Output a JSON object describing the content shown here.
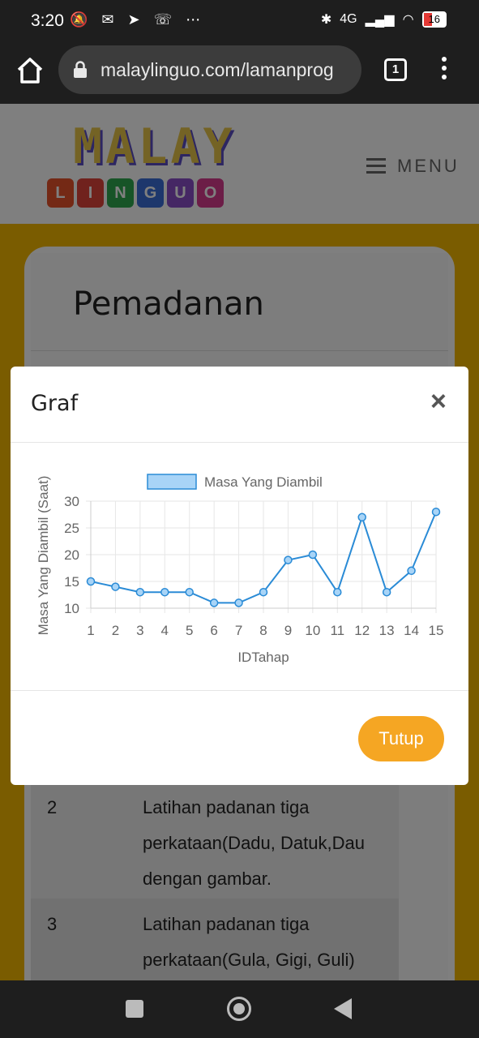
{
  "status_bar": {
    "time": "3:20",
    "icons": "🔕 ✉ ➤ ☏ ⋯",
    "network": "4G",
    "battery": "16"
  },
  "browser": {
    "url": "malaylinguo.com/lamanprog",
    "tab_count": "1"
  },
  "site": {
    "logo_top": "MALAY",
    "logo_letters": [
      "L",
      "I",
      "N",
      "G",
      "U",
      "O"
    ],
    "logo_colors": [
      "#e8522b",
      "#e0453a",
      "#2fa84f",
      "#3a6fd8",
      "#8a4fc9",
      "#d93a8f"
    ],
    "menu_label": "MENU"
  },
  "card": {
    "title": "Pemadanan",
    "rows": [
      {
        "num": "2",
        "lines": [
          "Latihan padanan tiga",
          "perkataan(Dadu, Datuk,Dau",
          "dengan gambar."
        ]
      },
      {
        "num": "3",
        "lines": [
          "Latihan padanan tiga",
          "perkataan(Gula, Gigi, Guli)"
        ]
      }
    ]
  },
  "modal": {
    "title": "Graf",
    "close_label": "×",
    "button_label": "Tutup"
  },
  "chart_data": {
    "type": "line",
    "legend": [
      "Masa Yang Diambil"
    ],
    "xlabel": "IDTahap",
    "ylabel": "Masa Yang Diambil (Saat)",
    "x": [
      1,
      2,
      3,
      4,
      5,
      6,
      7,
      8,
      9,
      10,
      11,
      12,
      13,
      14,
      15
    ],
    "series": [
      {
        "name": "Masa Yang Diambil",
        "values": [
          15,
          14,
          13,
          13,
          13,
          11,
          11,
          13,
          19,
          20,
          13,
          27,
          13,
          17,
          28
        ]
      }
    ],
    "ylim": [
      10,
      30
    ],
    "yticks": [
      10,
      15,
      20,
      25,
      30
    ],
    "grid": true,
    "colors": {
      "line": "#2a8bd6",
      "fill": "#a8d4f7",
      "grid": "#e6e6e6",
      "text": "#666666"
    }
  }
}
